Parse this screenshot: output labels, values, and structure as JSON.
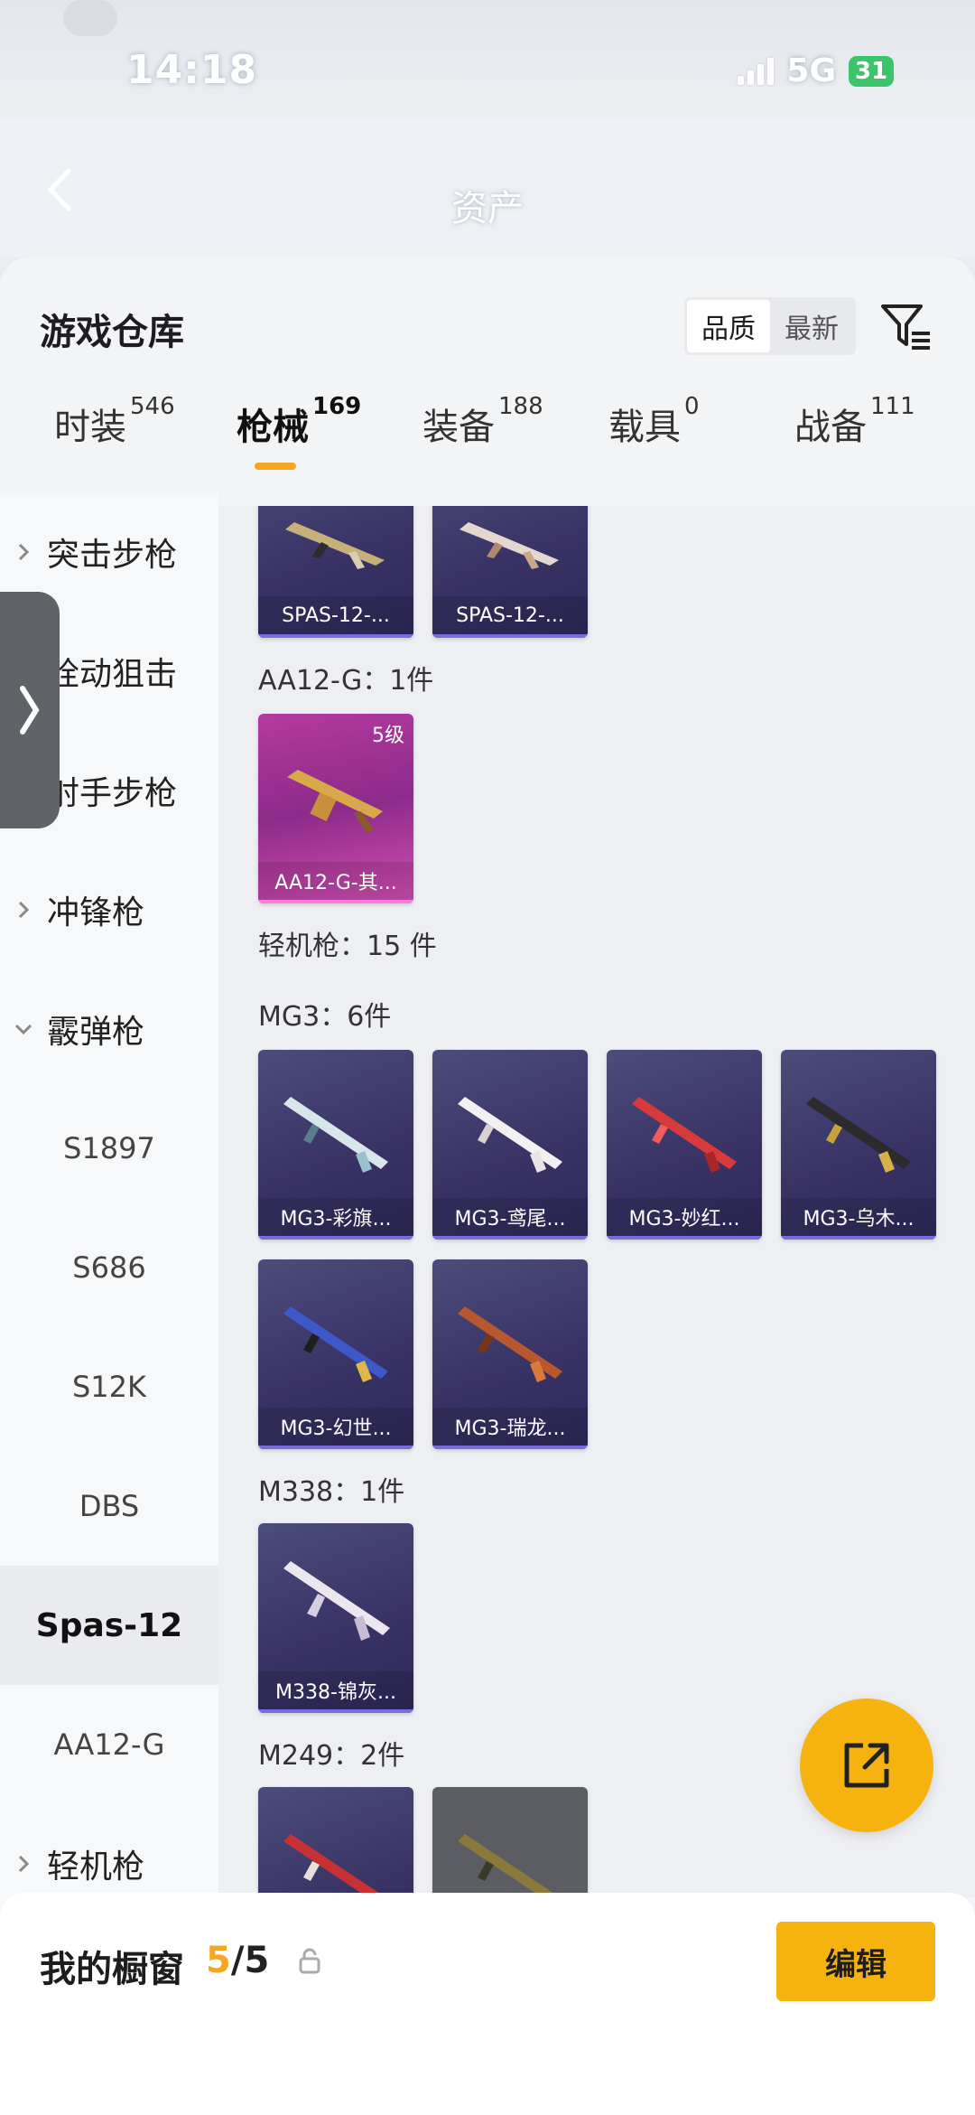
{
  "status_bar": {
    "time": "14:18",
    "network": "5G",
    "battery": "31"
  },
  "header": {
    "title": "资产"
  },
  "warehouse": {
    "title": "游戏仓库",
    "sort_options": [
      "品质",
      "最新"
    ],
    "active_sort": "品质"
  },
  "tabs": [
    {
      "label": "时装",
      "count": "546"
    },
    {
      "label": "枪械",
      "count": "169"
    },
    {
      "label": "装备",
      "count": "188"
    },
    {
      "label": "载具",
      "count": "0"
    },
    {
      "label": "战备",
      "count": "111"
    }
  ],
  "active_tab": "枪械",
  "sidebar": [
    {
      "label": "突击步枪",
      "expanded": false
    },
    {
      "label": "栓动狙击",
      "expanded": false
    },
    {
      "label": "射手步枪",
      "expanded": false
    },
    {
      "label": "冲锋枪",
      "expanded": false
    },
    {
      "label": "霰弹枪",
      "expanded": true
    },
    {
      "label": "S1897"
    },
    {
      "label": "S686"
    },
    {
      "label": "S12K"
    },
    {
      "label": "DBS"
    },
    {
      "label": "Spas-12",
      "selected": true
    },
    {
      "label": "AA12-G"
    },
    {
      "label": "轻机枪",
      "expanded": false
    }
  ],
  "content": {
    "groups": [
      {
        "label": "AA12-G：1件"
      },
      {
        "label": "轻机枪：15 件"
      },
      {
        "label": "MG3：6件"
      },
      {
        "label": "M338：1件"
      },
      {
        "label": "M249：2件"
      }
    ],
    "cards": [
      {
        "name": "SPAS-12-...",
        "rarity": "purple"
      },
      {
        "name": "SPAS-12-...",
        "rarity": "purple"
      },
      {
        "name": "AA12-G-其...",
        "rarity": "pink",
        "level": "5级"
      },
      {
        "name": "MG3-彩旗...",
        "rarity": "purple"
      },
      {
        "name": "MG3-鸢尾...",
        "rarity": "purple"
      },
      {
        "name": "MG3-妙红...",
        "rarity": "purple"
      },
      {
        "name": "MG3-乌木...",
        "rarity": "purple"
      },
      {
        "name": "MG3-幻世...",
        "rarity": "purple"
      },
      {
        "name": "MG3-瑞龙...",
        "rarity": "purple"
      },
      {
        "name": "M338-锦灰...",
        "rarity": "purple"
      }
    ]
  },
  "showcase": {
    "label": "我的橱窗",
    "current": "5",
    "total": "/5",
    "edit_label": "编辑"
  },
  "colors": {
    "accent": "#f6b20f",
    "purple_card": "#3a3366",
    "pink_card": "#b43aa0"
  }
}
